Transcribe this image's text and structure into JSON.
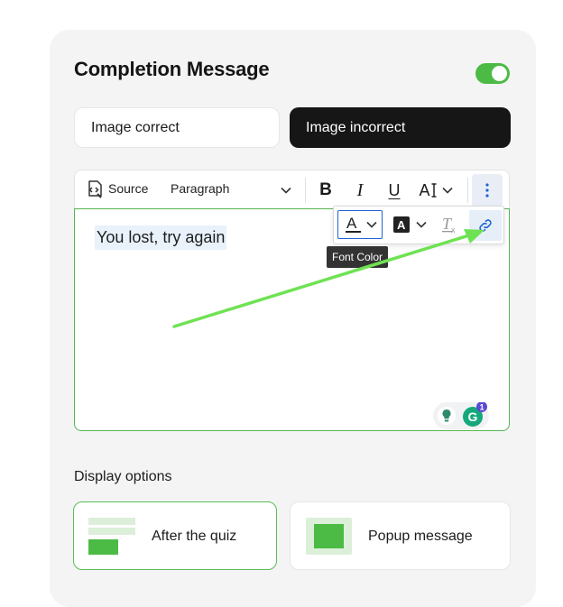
{
  "title": "Completion Message",
  "toggle": {
    "state": "on",
    "color": "#4cbb45"
  },
  "tabs": [
    {
      "label": "Image correct",
      "active": false
    },
    {
      "label": "Image incorrect",
      "active": true
    }
  ],
  "toolbar": {
    "source_label": "Source",
    "paragraph_label": "Paragraph",
    "bold": "B",
    "italic": "I",
    "underline": "U",
    "font_size": "A"
  },
  "editor": {
    "content": "You lost, try again"
  },
  "dropdown": {
    "font_color_glyph": "A",
    "bg_color_glyph": "A",
    "remove_format_glyph": "T",
    "remove_format_sub": "x"
  },
  "tooltip": "Font Color",
  "grammarly": {
    "badge_count": "1"
  },
  "display_options": {
    "label": "Display options",
    "options": [
      {
        "label": "After the quiz",
        "selected": true
      },
      {
        "label": "Popup message",
        "selected": false
      }
    ]
  },
  "colors": {
    "accent": "#4cbb45",
    "active_tab": "#161616",
    "highlight": "#e9f2fb",
    "arrow": "#6fe253",
    "focus_blue": "#1f62d6"
  }
}
